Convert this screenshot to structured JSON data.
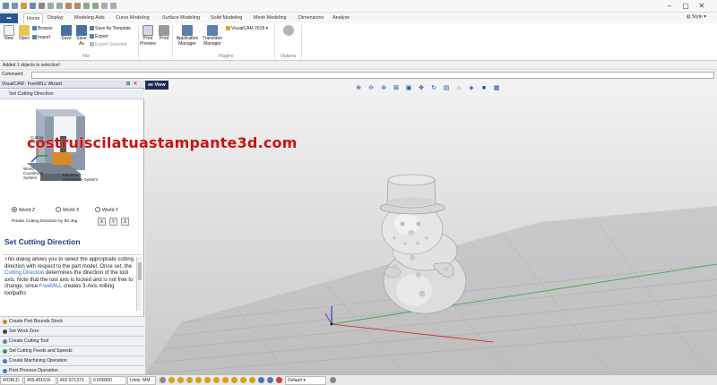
{
  "menu": {
    "file_label": "",
    "tabs": [
      "Home",
      "Display",
      "Modeling Aids",
      "Curve Modeling",
      "Surface Modeling",
      "Solid Modeling",
      "Mesh Modeling",
      "Dimensions",
      "Analyze"
    ],
    "active_tab": "Home",
    "style_label": "Style"
  },
  "ribbon": {
    "new_label": "New",
    "open_label": "Open",
    "browse_label": "Browse",
    "import_label": "Import",
    "save_label": "Save",
    "save_as_label": "Save As",
    "save_as_template_label": "Save As Template",
    "export_label": "Export",
    "export_selected_label": "Export Selected",
    "file_group_label": "File",
    "print_preview_label": "Print Preview",
    "print_label": "Print",
    "app_manager_label": "Application Manager",
    "translator_manager_label": "Translator Manager",
    "visualcam_label": "VisualCAM 2018",
    "plugins_group_label": "Plugins",
    "options_group_label": "Options"
  },
  "messages": {
    "status": "Added 1 objects to selection!",
    "command_label": "Command:",
    "command_value": ""
  },
  "panel": {
    "header": "VisualCAM : FreeMILL Wizard",
    "subheader": "Set Cutting Direction",
    "diagram_labels": {
      "cutting": "Cutting",
      "direction": "Direction",
      "world": "World",
      "coordinate": "Coordinate",
      "system": "System",
      "machine": "Machine",
      "machine_coord": "Coordinate System"
    },
    "radios": [
      {
        "label": "World Z",
        "selected": true
      },
      {
        "label": "World X",
        "selected": false
      },
      {
        "label": "World Y",
        "selected": false
      }
    ],
    "rotate_label": "Rotate Cutting Direction by 90 deg",
    "rotate_buttons": [
      "X",
      "Y",
      "Z"
    ],
    "help_title": "Set Cutting Direction",
    "help_text_1": "This dialog allows you to select the appropriate cutting direction with respect to the part model.  Once set, the ",
    "help_hl_1": "Cutting Direction",
    "help_text_2": " determines the direction of the tool axis.  Note that the tool axis is locked and is not free to change, since ",
    "help_hl_2": "FreeMILL",
    "help_text_3": " creates 3-Axis milling toolpaths",
    "steps": [
      "Create Part Bounds Stock",
      "Set Work Zero",
      "Create Cutting Tool",
      "Set Cutting Feeds and Speeds",
      "Create Machining Operation",
      "Post Process Operation"
    ]
  },
  "viewport": {
    "tab_label": "se View"
  },
  "statusbar": {
    "coord_system": "WORLD",
    "x": "459.401516",
    "y": "402.971373",
    "z": "0.000000",
    "units": "Units: MM",
    "layer": "Default"
  },
  "watermark": "costruiscilatuastampante3d.com",
  "colors": {
    "accent": "#2b579a",
    "help_title": "#1f3d7a",
    "watermark": "#cc1010"
  }
}
